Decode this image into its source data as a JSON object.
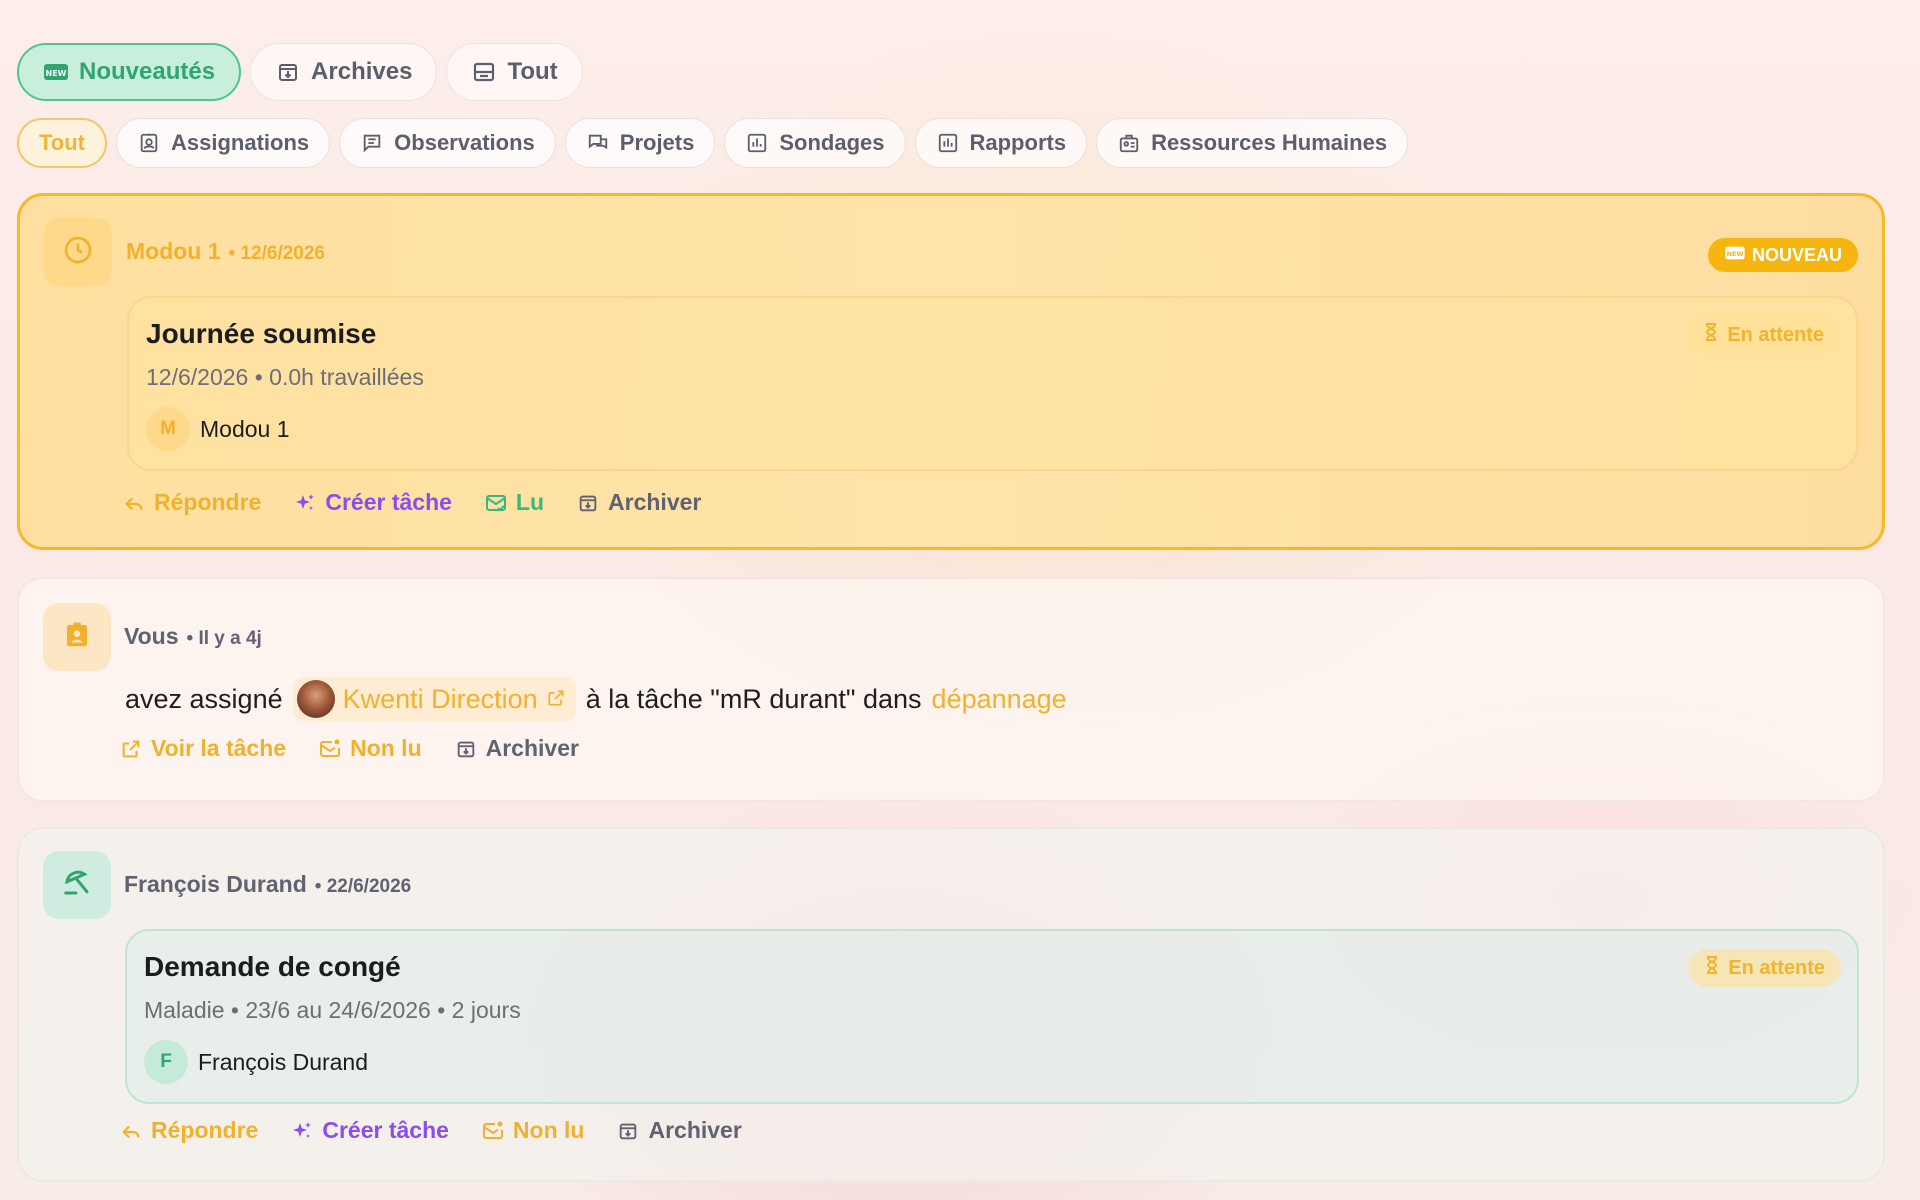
{
  "tabs": [
    {
      "label": "Nouveautés",
      "icon": "new-badge-icon",
      "active": true
    },
    {
      "label": "Archives",
      "icon": "archive-icon",
      "active": false
    },
    {
      "label": "Tout",
      "icon": "inbox-icon",
      "active": false
    }
  ],
  "filters": [
    {
      "label": "Tout",
      "icon": "",
      "active": true
    },
    {
      "label": "Assignations",
      "icon": "badge-icon"
    },
    {
      "label": "Observations",
      "icon": "comment-icon"
    },
    {
      "label": "Projets",
      "icon": "chat-icon"
    },
    {
      "label": "Sondages",
      "icon": "poll-icon"
    },
    {
      "label": "Rapports",
      "icon": "report-icon"
    },
    {
      "label": "Ressources Humaines",
      "icon": "hr-icon"
    }
  ],
  "notifications": [
    {
      "author": "Modou 1",
      "date": "• 12/6/2026",
      "badge": "NOUVEAU",
      "icon": "clock-icon",
      "title": "Journée soumise",
      "subtitle": "12/6/2026 • 0.0h travaillées",
      "status": "En attente",
      "person_initial": "M",
      "person_name": "Modou 1",
      "actions": [
        "Répondre",
        "Créer tâche",
        "Lu",
        "Archiver"
      ]
    },
    {
      "author": "Vous",
      "date": "• Il y a 4j",
      "icon": "assignment-icon",
      "text_before": "avez assigné",
      "mention": "Kwenti Direction",
      "text_middle": "à la tâche \"mR durant\" dans",
      "link": "dépannage",
      "actions": [
        "Voir la tâche",
        "Non lu",
        "Archiver"
      ]
    },
    {
      "author": "François Durand",
      "date": "• 22/6/2026",
      "icon": "beach-umbrella-icon",
      "title": "Demande de congé",
      "subtitle": "Maladie • 23/6 au 24/6/2026 • 2 jours",
      "status": "En attente",
      "person_initial": "F",
      "person_name": "François Durand",
      "actions": [
        "Répondre",
        "Créer tâche",
        "Non lu",
        "Archiver"
      ]
    }
  ],
  "colors": {
    "accent_yellow": "#f7b928",
    "accent_green": "#38b97a",
    "accent_purple": "#8a4df0"
  }
}
